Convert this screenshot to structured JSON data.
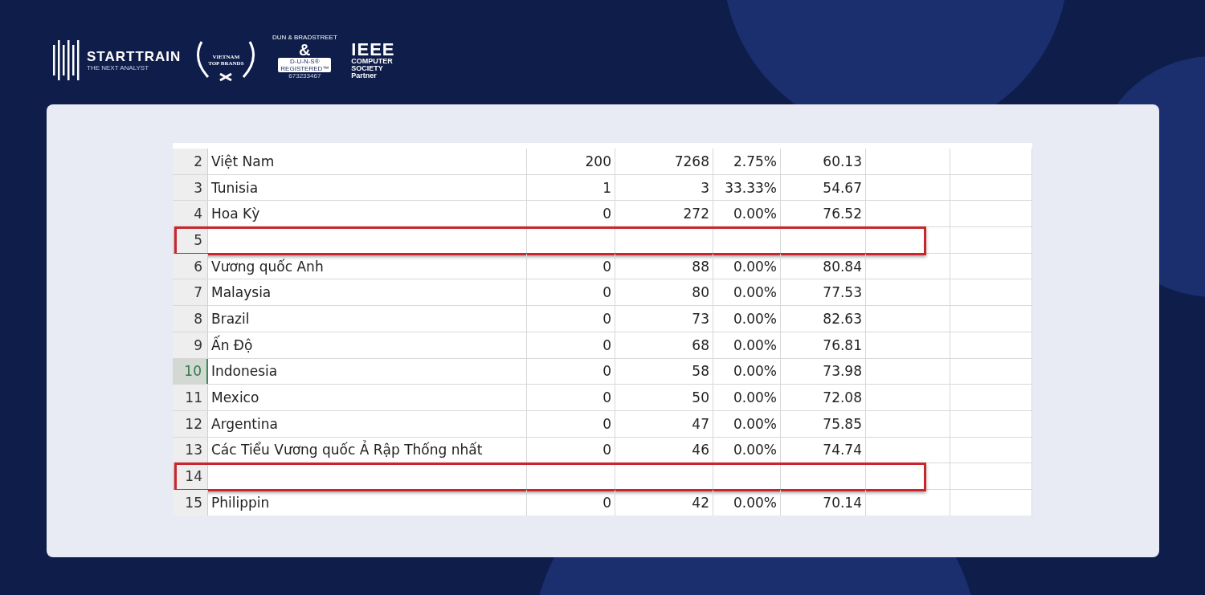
{
  "brand": {
    "name": "STARTTRAIN",
    "tagline": "THE NEXT ANALYST"
  },
  "badges": {
    "award": {
      "line_1": "VIETNAM",
      "line_2": "TOP BRANDS"
    },
    "duns": {
      "arc": "DUN & BRADSTREET",
      "symbol": "&",
      "label": "D-U-N-S®",
      "status": "REGISTERED™",
      "number": "673233467"
    },
    "ieee": {
      "title": "IEEE",
      "line_1": "COMPUTER",
      "line_2": "SOCIETY",
      "role": "Partner"
    }
  },
  "sheet": {
    "rows": [
      {
        "number": "2",
        "cells": [
          "Việt Nam",
          "200",
          "7268",
          "2.75%",
          "60.13"
        ],
        "selected": false,
        "highlighted": false
      },
      {
        "number": "3",
        "cells": [
          "Tunisia",
          "1",
          "3",
          "33.33%",
          "54.67"
        ],
        "selected": false,
        "highlighted": false
      },
      {
        "number": "4",
        "cells": [
          "Hoa Kỳ",
          "0",
          "272",
          "0.00%",
          "76.52"
        ],
        "selected": false,
        "highlighted": false
      },
      {
        "number": "5",
        "cells": [
          "",
          "",
          "",
          "",
          ""
        ],
        "selected": false,
        "highlighted": true
      },
      {
        "number": "6",
        "cells": [
          "Vương quốc Anh",
          "0",
          "88",
          "0.00%",
          "80.84"
        ],
        "selected": false,
        "highlighted": false
      },
      {
        "number": "7",
        "cells": [
          "Malaysia",
          "0",
          "80",
          "0.00%",
          "77.53"
        ],
        "selected": false,
        "highlighted": false
      },
      {
        "number": "8",
        "cells": [
          "Brazil",
          "0",
          "73",
          "0.00%",
          "82.63"
        ],
        "selected": false,
        "highlighted": false
      },
      {
        "number": "9",
        "cells": [
          "Ấn Độ",
          "0",
          "68",
          "0.00%",
          "76.81"
        ],
        "selected": false,
        "highlighted": false
      },
      {
        "number": "10",
        "cells": [
          "Indonesia",
          "0",
          "58",
          "0.00%",
          "73.98"
        ],
        "selected": true,
        "highlighted": false
      },
      {
        "number": "11",
        "cells": [
          "Mexico",
          "0",
          "50",
          "0.00%",
          "72.08"
        ],
        "selected": false,
        "highlighted": false
      },
      {
        "number": "12",
        "cells": [
          "Argentina",
          "0",
          "47",
          "0.00%",
          "75.85"
        ],
        "selected": false,
        "highlighted": false
      },
      {
        "number": "13",
        "cells": [
          "Các Tiểu Vương quốc Ả Rập Thống nhất",
          "0",
          "46",
          "0.00%",
          "74.74"
        ],
        "selected": false,
        "highlighted": false
      },
      {
        "number": "14",
        "cells": [
          "",
          "",
          "",
          "",
          ""
        ],
        "selected": false,
        "highlighted": true
      },
      {
        "number": "15",
        "cells": [
          "Philippin",
          "0",
          "42",
          "0.00%",
          "70.14"
        ],
        "selected": false,
        "highlighted": false
      }
    ]
  }
}
